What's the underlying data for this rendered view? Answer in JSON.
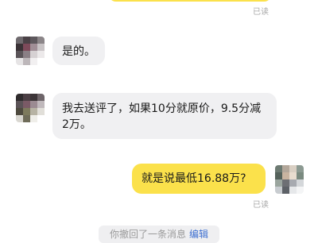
{
  "messages": [
    {
      "direction": "out",
      "text": "",
      "status": "已读"
    },
    {
      "direction": "in",
      "text": "是的。"
    },
    {
      "direction": "in",
      "text": "我去送评了，如果10分就原价，9.5分减2万。"
    },
    {
      "direction": "out",
      "text": "就是说最低16.88万?",
      "status": "已读"
    }
  ],
  "system_notice": {
    "text": "你撤回了一条消息",
    "action_label": "编辑"
  },
  "colors": {
    "outgoing_bubble": "#fbe14b",
    "incoming_bubble": "#f0f0f2",
    "link": "#3d6fd1",
    "read_status": "#a8a8a8"
  }
}
